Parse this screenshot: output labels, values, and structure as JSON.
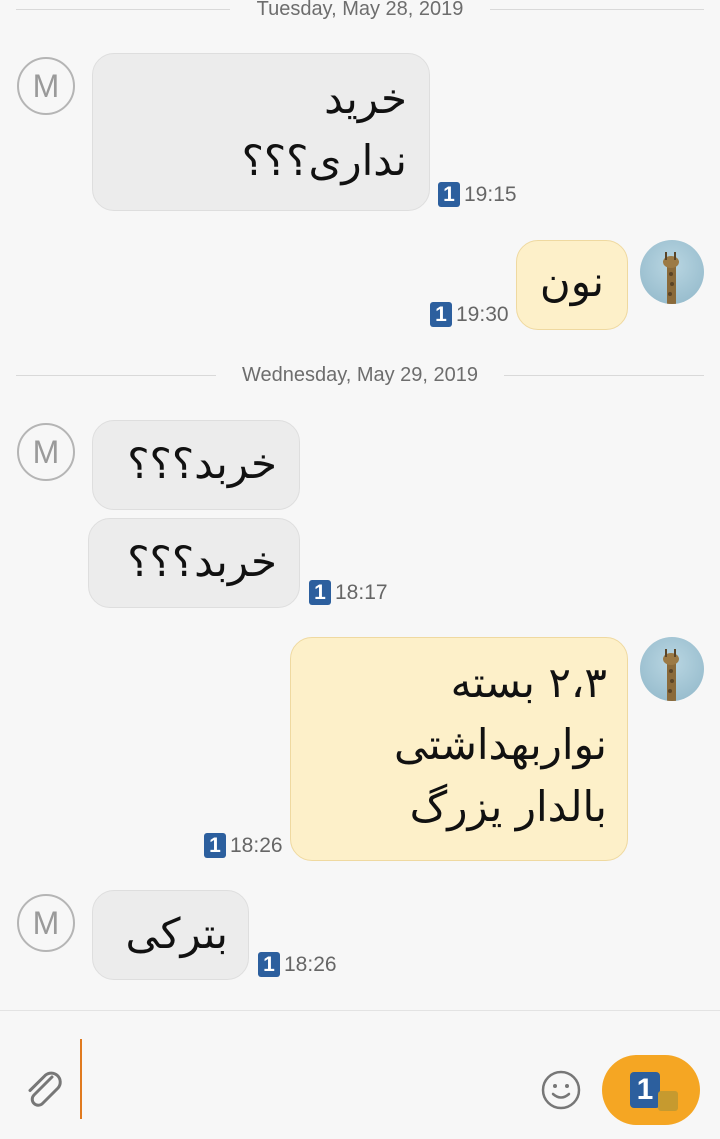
{
  "conversation": {
    "dates": [
      "Tuesday, May 28, 2019",
      "Wednesday, May 29, 2019"
    ],
    "contact_initial": "M",
    "messages": [
      {
        "direction": "in",
        "lines": [
          "خرید",
          "نداری؟؟؟"
        ],
        "sim": "1",
        "time": "19:15"
      },
      {
        "direction": "out",
        "lines": [
          "نون"
        ],
        "sim": "1",
        "time": "19:30"
      },
      {
        "direction": "in",
        "lines": [
          "خربد؟؟؟"
        ]
      },
      {
        "direction": "in",
        "lines": [
          "خربد؟؟؟"
        ],
        "sim": "1",
        "time": "18:17"
      },
      {
        "direction": "out",
        "lines": [
          "۲،۳ بسته",
          "نواربهداشتی",
          "بالدار یزرگ"
        ],
        "sim": "1",
        "time": "18:26"
      },
      {
        "direction": "in",
        "lines": [
          "بترکی"
        ],
        "sim": "1",
        "time": "18:26"
      }
    ]
  },
  "composer": {
    "attach_icon": "paperclip-icon",
    "emoji_icon": "smiley-icon",
    "send_sim": "1",
    "send_icon": "sim-send-icon"
  },
  "colors": {
    "incoming_bubble": "#ececec",
    "outgoing_bubble": "#fdf0c9",
    "sim_badge": "#2c5f9e",
    "send_button": "#f5a623",
    "cursor": "#e07a1f"
  }
}
